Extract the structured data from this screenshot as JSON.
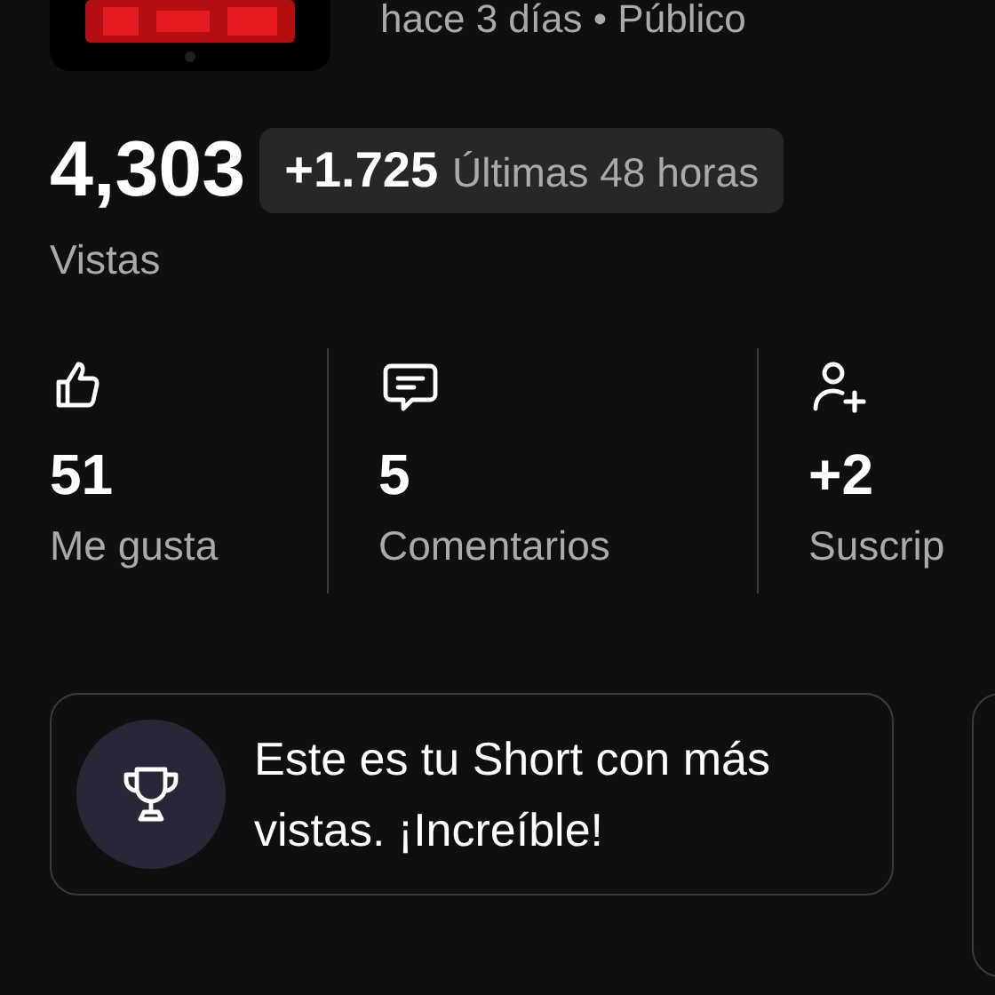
{
  "video": {
    "meta": "hace 3 días • Público"
  },
  "views": {
    "count": "4,303",
    "delta": "+1.725",
    "period": "Últimas 48 horas",
    "label": "Vistas"
  },
  "stats": [
    {
      "kind": "likes",
      "value": "51",
      "label": "Me gusta"
    },
    {
      "kind": "comments",
      "value": "5",
      "label": "Comentarios"
    },
    {
      "kind": "subscribers",
      "value": "+2",
      "label": "Suscrip"
    }
  ],
  "insights": [
    {
      "kind": "trophy",
      "text": "Este es tu Short con más vistas. ¡Increíble!"
    }
  ]
}
